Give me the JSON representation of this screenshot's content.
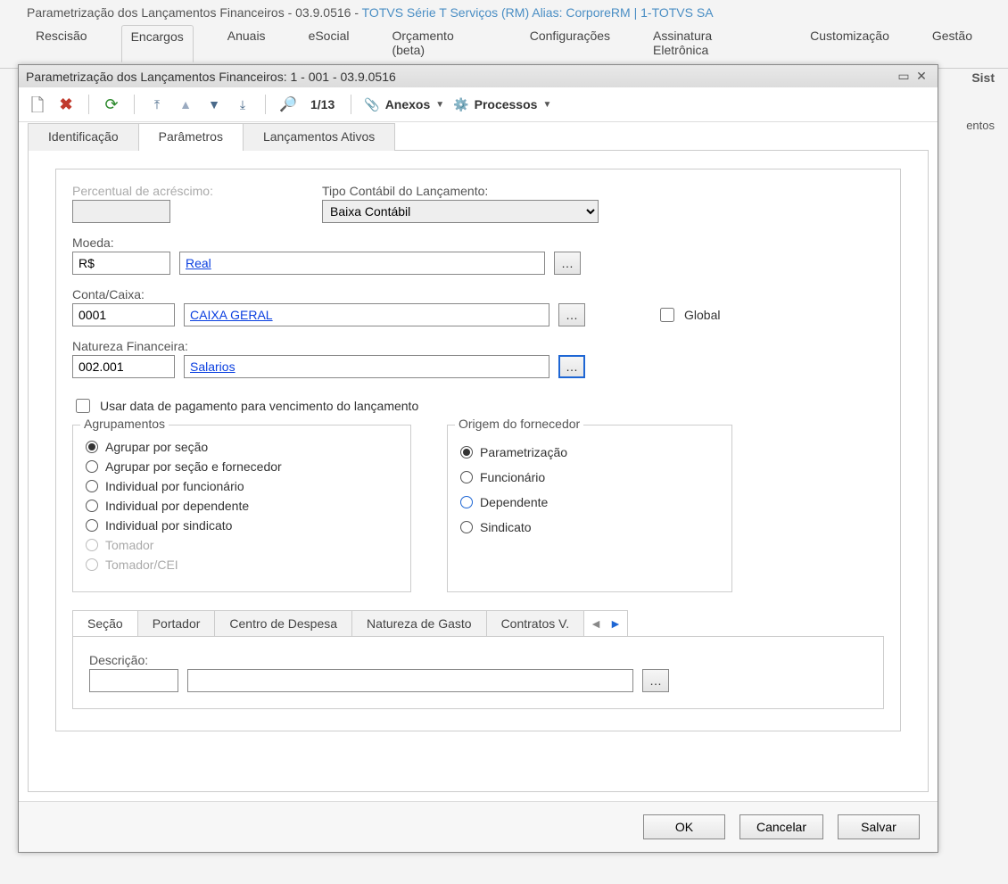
{
  "app_title": {
    "left": "Parametrização dos Lançamentos Financeiros - 03.9.0516 - ",
    "right": "TOTVS Série T Serviços (RM) Alias: CorporeRM | 1-TOTVS SA"
  },
  "ribbon_tabs": [
    "Rescisão",
    "Encargos",
    "Anuais",
    "eSocial",
    "Orçamento (beta)",
    "Configurações",
    "Assinatura Eletrônica",
    "Customização"
  ],
  "ribbon_right": [
    "Sist",
    "Gestão"
  ],
  "right_clip2": "Sist",
  "right_clip": "entos",
  "dialog": {
    "title": "Parametrização dos Lançamentos Financeiros: 1 - 001 - 03.9.0516",
    "toolbar": {
      "counter": "1/13",
      "anexos": "Anexos",
      "processos": "Processos"
    },
    "tabs": [
      "Identificação",
      "Parâmetros",
      "Lançamentos Ativos"
    ],
    "form": {
      "percent_label": "Percentual de acréscimo:",
      "tipo_label": "Tipo Contábil do Lançamento:",
      "tipo_value": "Baixa Contábil",
      "moeda_label": "Moeda:",
      "moeda_code": "R$",
      "moeda_desc": "Real",
      "conta_label": "Conta/Caixa:",
      "conta_code": "0001",
      "conta_desc": "CAIXA GERAL",
      "global_label": "Global",
      "natureza_label": "Natureza Financeira:",
      "natureza_code": "002.001",
      "natureza_desc": "Salarios",
      "usar_data_label": "Usar data de pagamento para vencimento do lançamento"
    },
    "agrupamentos": {
      "legend": "Agrupamentos",
      "options": [
        "Agrupar por seção",
        "Agrupar por seção e fornecedor",
        "Individual por funcionário",
        "Individual por dependente",
        "Individual por sindicato",
        "Tomador",
        "Tomador/CEI"
      ]
    },
    "origem": {
      "legend": "Origem do fornecedor",
      "options": [
        "Parametrização",
        "Funcionário",
        "Dependente",
        "Sindicato"
      ]
    },
    "subtabs": [
      "Seção",
      "Portador",
      "Centro de Despesa",
      "Natureza de Gasto",
      "Contratos V."
    ],
    "subform": {
      "descricao_label": "Descrição:"
    },
    "buttons": {
      "ok": "OK",
      "cancel": "Cancelar",
      "save": "Salvar"
    }
  }
}
